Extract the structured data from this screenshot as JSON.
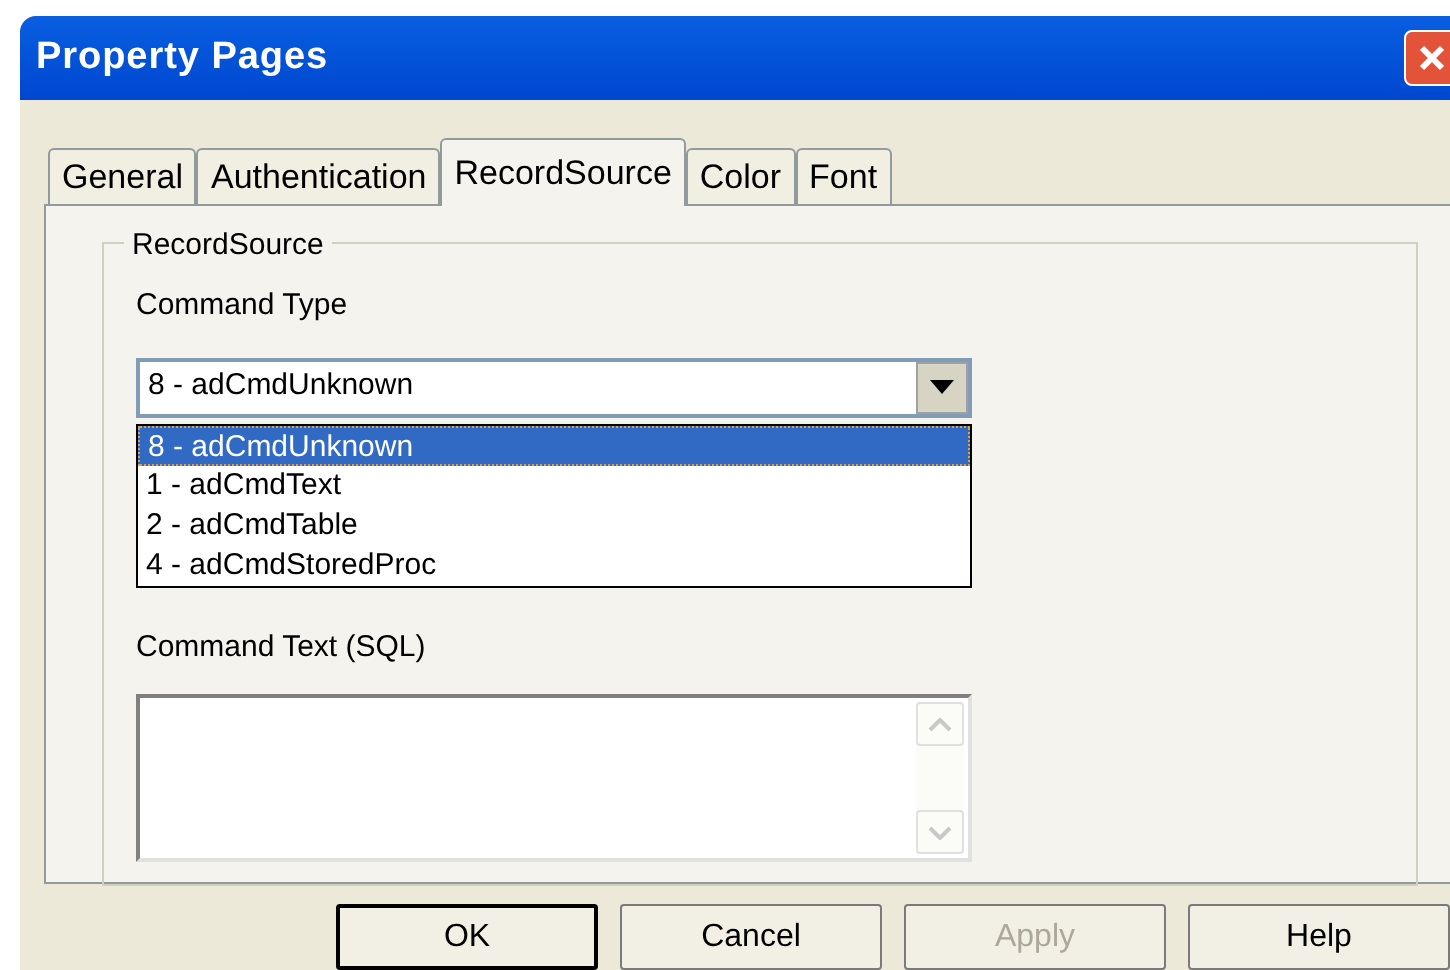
{
  "window": {
    "title": "Property Pages"
  },
  "tabs": [
    {
      "label": "General",
      "selected": false
    },
    {
      "label": "Authentication",
      "selected": false
    },
    {
      "label": "RecordSource",
      "selected": true
    },
    {
      "label": "Color",
      "selected": false
    },
    {
      "label": "Font",
      "selected": false
    }
  ],
  "group": {
    "label": "RecordSource"
  },
  "command_type": {
    "label": "Command Type",
    "value": "8 - adCmdUnknown",
    "expanded": true,
    "options": [
      {
        "label": "8 - adCmdUnknown",
        "selected": true
      },
      {
        "label": "1 - adCmdText",
        "selected": false
      },
      {
        "label": "2 - adCmdTable",
        "selected": false
      },
      {
        "label": "4 - adCmdStoredProc",
        "selected": false
      }
    ]
  },
  "command_text": {
    "label": "Command Text (SQL)",
    "disabled": true
  },
  "buttons": [
    {
      "label": "OK",
      "default": true,
      "disabled": false
    },
    {
      "label": "Cancel",
      "default": false,
      "disabled": false
    },
    {
      "label": "Apply",
      "default": false,
      "disabled": true
    },
    {
      "label": "Help",
      "default": false,
      "disabled": false
    }
  ]
}
